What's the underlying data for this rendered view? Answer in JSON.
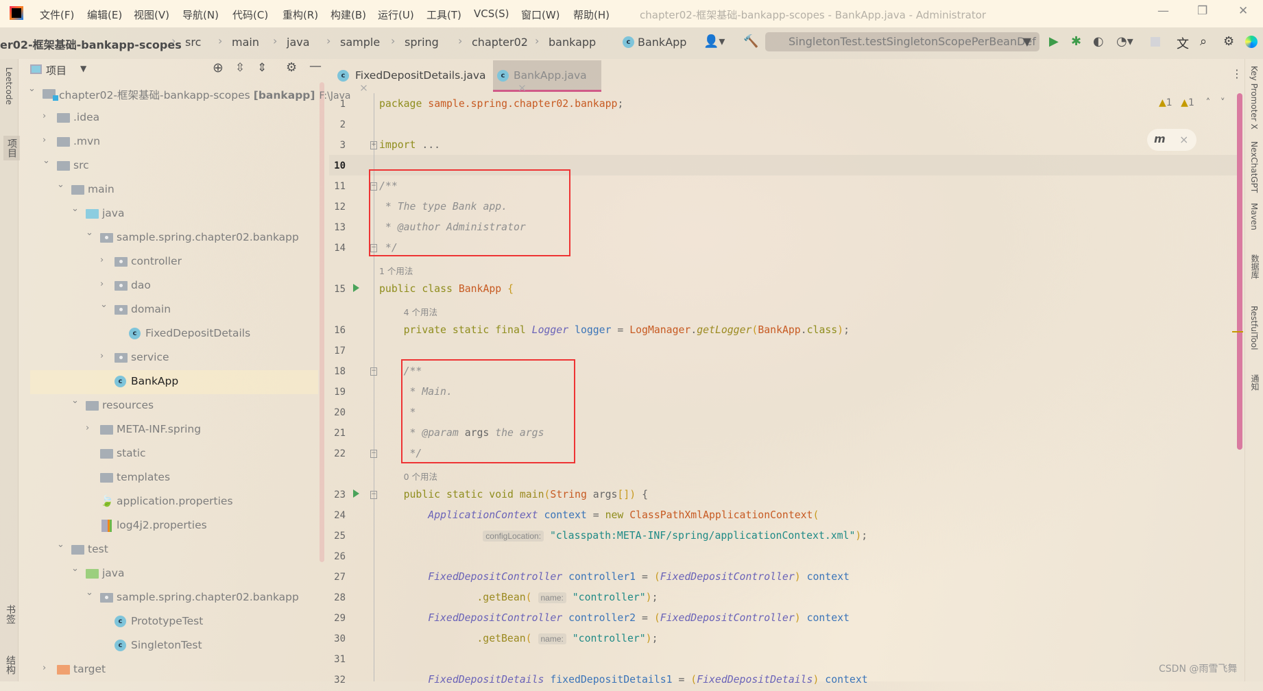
{
  "window": {
    "title": "chapter02-框架基础-bankapp-scopes - BankApp.java - Administrator",
    "minimize": "—",
    "restore": "❐",
    "close": "✕"
  },
  "menu": [
    "文件(F)",
    "编辑(E)",
    "视图(V)",
    "导航(N)",
    "代码(C)",
    "重构(R)",
    "构建(B)",
    "运行(U)",
    "工具(T)",
    "VCS(S)",
    "窗口(W)",
    "帮助(H)"
  ],
  "breadcrumb": [
    "er02-框架基础-bankapp-scopes",
    "src",
    "main",
    "java",
    "sample",
    "spring",
    "chapter02",
    "bankapp",
    "BankApp"
  ],
  "toolbar": {
    "run_config": "SingletonTest.testSingletonScopePerBeanDef"
  },
  "left_stripe": {
    "leetcode": "Leetcode",
    "project": "项目",
    "bookmarks": "书签",
    "structure": "结构"
  },
  "project_panel": {
    "title": "项目",
    "items": [
      {
        "label": "chapter02-框架基础-bankapp-scopes",
        "bold": "[bankapp]",
        "path": "F:\\Java",
        "depth": 0,
        "exp": "open",
        "icon": "module"
      },
      {
        "label": ".idea",
        "depth": 1,
        "exp": "closed",
        "icon": "folder"
      },
      {
        "label": ".mvn",
        "depth": 1,
        "exp": "closed",
        "icon": "folder"
      },
      {
        "label": "src",
        "depth": 1,
        "exp": "open",
        "icon": "folder"
      },
      {
        "label": "main",
        "depth": 2,
        "exp": "open",
        "icon": "folder"
      },
      {
        "label": "java",
        "depth": 3,
        "exp": "open",
        "icon": "source-folder"
      },
      {
        "label": "sample.spring.chapter02.bankapp",
        "depth": 4,
        "exp": "open",
        "icon": "package"
      },
      {
        "label": "controller",
        "depth": 5,
        "exp": "closed",
        "icon": "package"
      },
      {
        "label": "dao",
        "depth": 5,
        "exp": "closed",
        "icon": "package"
      },
      {
        "label": "domain",
        "depth": 5,
        "exp": "open",
        "icon": "package"
      },
      {
        "label": "FixedDepositDetails",
        "depth": 6,
        "icon": "class"
      },
      {
        "label": "service",
        "depth": 5,
        "exp": "closed",
        "icon": "package"
      },
      {
        "label": "BankApp",
        "depth": 5,
        "icon": "class",
        "selected": true
      },
      {
        "label": "resources",
        "depth": 3,
        "exp": "open",
        "icon": "resources-folder"
      },
      {
        "label": "META-INF.spring",
        "depth": 4,
        "exp": "closed",
        "icon": "folder"
      },
      {
        "label": "static",
        "depth": 4,
        "icon": "folder"
      },
      {
        "label": "templates",
        "depth": 4,
        "icon": "folder"
      },
      {
        "label": "application.properties",
        "depth": 4,
        "icon": "spring-properties"
      },
      {
        "label": "log4j2.properties",
        "depth": 4,
        "icon": "properties"
      },
      {
        "label": "test",
        "depth": 2,
        "exp": "open",
        "icon": "folder"
      },
      {
        "label": "java",
        "depth": 3,
        "exp": "open",
        "icon": "test-folder"
      },
      {
        "label": "sample.spring.chapter02.bankapp",
        "depth": 4,
        "exp": "open",
        "icon": "package"
      },
      {
        "label": "PrototypeTest",
        "depth": 5,
        "icon": "test-class"
      },
      {
        "label": "SingletonTest",
        "depth": 5,
        "icon": "test-class"
      },
      {
        "label": "target",
        "depth": 1,
        "exp": "closed",
        "icon": "excluded-folder"
      }
    ]
  },
  "tabs": [
    {
      "label": "FixedDepositDetails.java",
      "active": false
    },
    {
      "label": "BankApp.java",
      "active": true
    }
  ],
  "inspections": {
    "warnings": "1",
    "weak_warnings": "1"
  },
  "right_stripe": [
    "Key Promoter X",
    "NexChatGPT",
    "Maven",
    "数据库",
    "RestfulTool",
    "通知"
  ],
  "code": [
    {
      "n": "1",
      "pad": 0,
      "s": [
        [
          "kw",
          "package "
        ],
        [
          "pk",
          "sample.spring.chapter02.bankapp"
        ],
        [
          "p",
          ";"
        ]
      ]
    },
    {
      "n": "2",
      "pad": 0,
      "s": []
    },
    {
      "n": "3",
      "pad": 0,
      "fold": "+",
      "s": [
        [
          "kw",
          "import "
        ],
        [
          "p",
          "..."
        ]
      ]
    },
    {
      "n": "10",
      "pad": 0,
      "cur": true,
      "s": []
    },
    {
      "n": "11",
      "pad": 0,
      "fold": "-",
      "s": [
        [
          "cm",
          "/**"
        ]
      ]
    },
    {
      "n": "12",
      "pad": 0,
      "s": [
        [
          "cm",
          " * The type Bank app."
        ]
      ]
    },
    {
      "n": "13",
      "pad": 0,
      "s": [
        [
          "cm",
          " * @author Administrator"
        ]
      ]
    },
    {
      "n": "14",
      "pad": 0,
      "fold": "-",
      "s": [
        [
          "cm",
          " */"
        ]
      ]
    },
    {
      "hint": "1 个用法",
      "pad": 0
    },
    {
      "n": "15",
      "pad": 0,
      "run": true,
      "s": [
        [
          "kw",
          "public class "
        ],
        [
          "cn",
          "BankApp "
        ],
        [
          "br",
          "{"
        ]
      ]
    },
    {
      "hint": "4 个用法",
      "pad": 4
    },
    {
      "n": "16",
      "pad": 4,
      "s": [
        [
          "kw",
          "private static final "
        ],
        [
          "ty",
          "Logger "
        ],
        [
          "fd",
          "logger "
        ],
        [
          "p",
          "= "
        ],
        [
          "cn",
          "LogManager"
        ],
        [
          "p",
          "."
        ],
        [
          "fn",
          "getLogger"
        ],
        [
          "br",
          "("
        ],
        [
          "cn",
          "BankApp"
        ],
        [
          "p",
          "."
        ],
        [
          "kw",
          "class"
        ],
        [
          "br",
          ")"
        ],
        [
          "p",
          ";"
        ]
      ]
    },
    {
      "n": "17",
      "pad": 0,
      "s": []
    },
    {
      "n": "18",
      "pad": 4,
      "fold": "-",
      "s": [
        [
          "cm",
          "/**"
        ]
      ]
    },
    {
      "n": "19",
      "pad": 4,
      "s": [
        [
          "cm",
          " * Main."
        ]
      ]
    },
    {
      "n": "20",
      "pad": 4,
      "s": [
        [
          "cm",
          " *"
        ]
      ]
    },
    {
      "n": "21",
      "pad": 4,
      "s": [
        [
          "cm",
          " * @param "
        ],
        [
          "ar",
          "args"
        ],
        [
          "cm",
          " the args"
        ]
      ]
    },
    {
      "n": "22",
      "pad": 4,
      "fold": "-",
      "s": [
        [
          "cm",
          " */"
        ]
      ]
    },
    {
      "hint": "0 个用法",
      "pad": 4
    },
    {
      "n": "23",
      "pad": 4,
      "run": true,
      "fold": "-",
      "s": [
        [
          "kw",
          "public static void "
        ],
        [
          "me",
          "main"
        ],
        [
          "br",
          "("
        ],
        [
          "cn",
          "String "
        ],
        [
          "ar",
          "args"
        ],
        [
          "br",
          "[]) "
        ],
        [
          "p",
          "{"
        ]
      ]
    },
    {
      "n": "24",
      "pad": 8,
      "s": [
        [
          "ty",
          "ApplicationContext "
        ],
        [
          "fd",
          "context "
        ],
        [
          "p",
          "= "
        ],
        [
          "kw",
          "new "
        ],
        [
          "cn",
          "ClassPathXmlApplicationContext"
        ],
        [
          "br",
          "("
        ]
      ]
    },
    {
      "n": "25",
      "pad": 17,
      "s": [
        [
          "ih",
          "configLocation:"
        ],
        [
          "st",
          " \"classpath:META-INF/spring/applicationContext.xml\""
        ],
        [
          "br",
          ")"
        ],
        [
          "p",
          ";"
        ]
      ]
    },
    {
      "n": "26",
      "pad": 0,
      "s": []
    },
    {
      "n": "27",
      "pad": 8,
      "s": [
        [
          "ty",
          "FixedDepositController "
        ],
        [
          "fd",
          "controller1 "
        ],
        [
          "p",
          "= "
        ],
        [
          "br",
          "("
        ],
        [
          "ty",
          "FixedDepositController"
        ],
        [
          "br",
          ") "
        ],
        [
          "fd",
          "context"
        ]
      ]
    },
    {
      "n": "28",
      "pad": 16,
      "s": [
        [
          "me",
          ".getBean"
        ],
        [
          "br",
          "( "
        ],
        [
          "ih",
          "name:"
        ],
        [
          "st",
          " \"controller\""
        ],
        [
          "br",
          ")"
        ],
        [
          "p",
          ";"
        ]
      ]
    },
    {
      "n": "29",
      "pad": 8,
      "s": [
        [
          "ty",
          "FixedDepositController "
        ],
        [
          "fd",
          "controller2 "
        ],
        [
          "p",
          "= "
        ],
        [
          "br",
          "("
        ],
        [
          "ty",
          "FixedDepositController"
        ],
        [
          "br",
          ") "
        ],
        [
          "fd",
          "context"
        ]
      ]
    },
    {
      "n": "30",
      "pad": 16,
      "s": [
        [
          "me",
          ".getBean"
        ],
        [
          "br",
          "( "
        ],
        [
          "ih",
          "name:"
        ],
        [
          "st",
          " \"controller\""
        ],
        [
          "br",
          ")"
        ],
        [
          "p",
          ";"
        ]
      ]
    },
    {
      "n": "31",
      "pad": 0,
      "s": []
    },
    {
      "n": "32",
      "pad": 8,
      "s": [
        [
          "ty",
          "FixedDepositDetails "
        ],
        [
          "fd",
          "fixedDepositDetails1 "
        ],
        [
          "p",
          "= "
        ],
        [
          "br",
          "("
        ],
        [
          "ty",
          "FixedDepositDetails"
        ],
        [
          "br",
          ") "
        ],
        [
          "fd",
          "context"
        ]
      ]
    }
  ],
  "watermark": "CSDN @雨雪飞舞"
}
